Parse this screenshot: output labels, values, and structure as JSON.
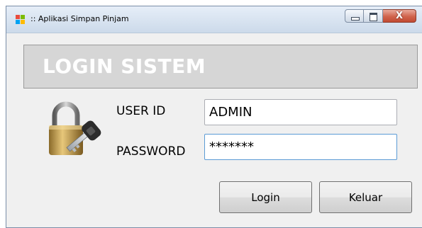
{
  "window": {
    "title": ":: Aplikasi Simpan Pinjam",
    "app_icon": "windows-form-icon",
    "controls": {
      "minimize": "minimize-icon",
      "maximize": "maximize-icon",
      "close": "close-icon",
      "close_glyph": "X"
    }
  },
  "banner": {
    "title": "LOGIN SISTEM"
  },
  "form": {
    "icon": "padlock-key-icon",
    "user_label": "USER ID",
    "user_value": "ADMIN",
    "password_label": "PASSWORD",
    "password_value": "*******"
  },
  "buttons": {
    "login": "Login",
    "exit": "Keluar"
  },
  "colors": {
    "close_button": "#c94e36",
    "banner_bg": "#d6d6d6",
    "banner_text": "#ffffff",
    "focus_border": "#5b9bd5"
  }
}
